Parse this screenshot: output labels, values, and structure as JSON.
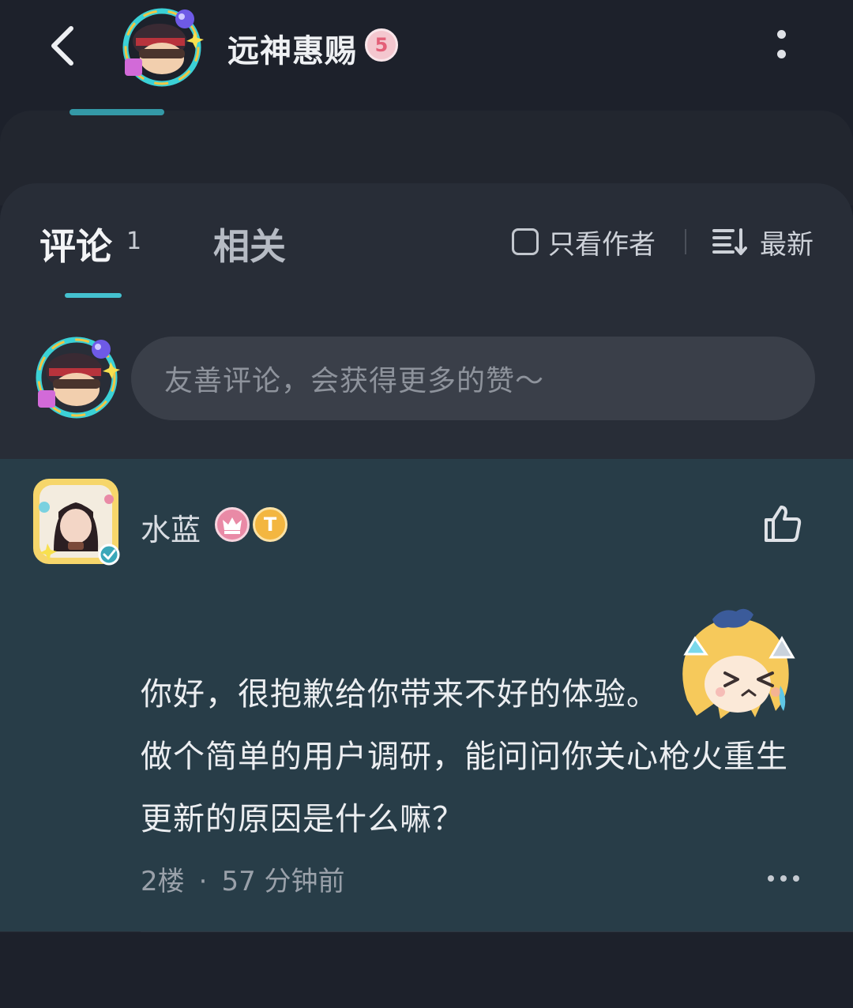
{
  "header": {
    "title": "远神惠赐",
    "level": "5"
  },
  "tabs": {
    "comments_label": "评论",
    "comments_count": "1",
    "related_label": "相关"
  },
  "filters": {
    "author_only_label": "只看作者",
    "sort_label": "最新"
  },
  "comment_input": {
    "placeholder": "友善评论，会获得更多的赞～"
  },
  "comment": {
    "author": "水蓝",
    "t_badge": "T",
    "text_lines": [
      "你好，很抱歉给你带来不好的体验。",
      "做个简单的用户调研，能问问你关心枪火重生",
      "更新的原因是什么嘛？"
    ],
    "floor": "2楼",
    "time": "57 分钟前"
  },
  "colors": {
    "background": "#1d212b",
    "sheet": "#282d37",
    "highlight": "#283d48",
    "accent": "#44c1cf"
  },
  "icons": [
    "back-arrow-icon",
    "more-vertical-icon",
    "checkbox-icon",
    "sort-icon",
    "thumbs-up-icon",
    "more-horizontal-icon"
  ]
}
